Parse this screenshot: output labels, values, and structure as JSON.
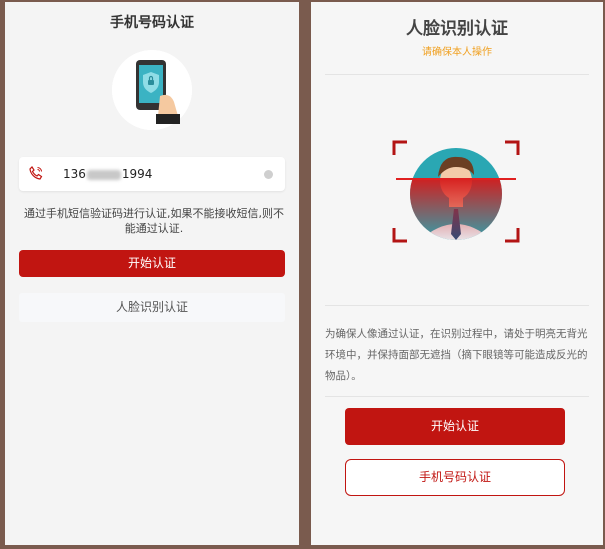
{
  "left": {
    "title": "手机号码认证",
    "phone_prefix": "136",
    "phone_suffix": "1994",
    "description": "通过手机短信验证码进行认证,如果不能接收短信,则不能通过认证.",
    "start_button": "开始认证",
    "face_button": "人脸识别认证"
  },
  "right": {
    "title": "人脸识别认证",
    "subtitle": "请确保本人操作",
    "notice": "为确保人像通过认证，在识别过程中，请处于明亮无背光环境中，并保持面部无遮挡（摘下眼镜等可能造成反光的物品）。",
    "start_button": "开始认证",
    "phone_button": "手机号码认证"
  },
  "colors": {
    "brand_red": "#c11511",
    "subtitle_orange": "#f0a020",
    "frame_bg": "#7a5b4e"
  },
  "icons": [
    "phone-shield-illustration",
    "phone-icon",
    "clear-icon",
    "face-scan-illustration"
  ]
}
